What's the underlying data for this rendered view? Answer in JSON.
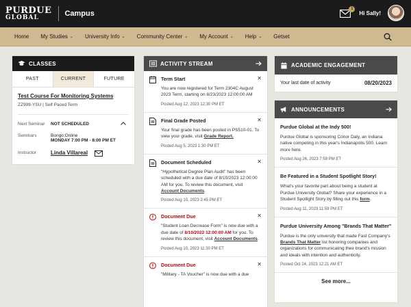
{
  "header": {
    "logo_line1": "PURDUE",
    "logo_line2": "GLOBAL",
    "campus": "Campus",
    "mail_count": "1",
    "greeting": "Hi Sally!"
  },
  "nav": {
    "items": [
      {
        "label": "Home",
        "dropdown": false
      },
      {
        "label": "My Studies",
        "dropdown": true
      },
      {
        "label": "University Info",
        "dropdown": true
      },
      {
        "label": "Community Center",
        "dropdown": true
      },
      {
        "label": "My Account",
        "dropdown": true
      },
      {
        "label": "Help",
        "dropdown": true
      },
      {
        "label": "Getset",
        "dropdown": false
      }
    ],
    "chevron": "⌄"
  },
  "classes": {
    "title": "CLASSES",
    "tabs": [
      "PAST",
      "CURRENT",
      "FUTURE"
    ],
    "course_title": "Test Course For Monitoring Systems",
    "course_sub": "ZZ999-YSU | Self Paced Term",
    "next_seminar_label": "Next Seminar",
    "next_seminar_value": "NOT SCHEDULED",
    "seminars_label": "Seminars",
    "seminars_value1": "Bongo:Online",
    "seminars_value2": "MONDAY 7:00 PM - 8:00 PM ET",
    "instructor_label": "Instructor",
    "instructor_name": "Linda Villareal"
  },
  "activity": {
    "title": "ACTIVITY STREAM",
    "items": [
      {
        "title": "Term Start",
        "body": "You are now registered for Term 2304C August 2023 Term, starting on 8/23/2023 12:00:00 AM",
        "date": "Posted Aug 12, 2023   12:30 PM ET"
      },
      {
        "title": "Final Grade Posted",
        "body_pre": "Your final grade has been posted in PS510-01. To view your grade, visit ",
        "body_link": "Grade Report.",
        "date": "Posted Aug 5, 2023   1:30 PM ET"
      },
      {
        "title": "Document Scheduled",
        "body_pre": "\"Hypothetical Degree Plan Audit\" has been scheduled with a due date of 8/10/2023 12:00:00 AM for you. To review this document, visit ",
        "body_link": "Account Documents",
        "body_post": ".",
        "date": "Posted Aug 10, 2023   2:45 PM ET"
      },
      {
        "title": "Document Due",
        "body_pre": "\"Student Loan Decrease Form\" is now due with a due date of ",
        "body_red": "8/10/2022 12:00:00 AM",
        "body_mid": " for you. To review this document, visit ",
        "body_link": "Account Documents",
        "body_post": ".",
        "date": "Posted Aug 10, 2023   11:30 PM ET"
      },
      {
        "title": "Document Due",
        "body_pre": "\"Military - TA Voucher\" is now due with a due"
      }
    ]
  },
  "engagement": {
    "title": "ACADEMIC ENGAGEMENT",
    "label": "Your last date of activity",
    "date": "08/20/2023"
  },
  "announcements": {
    "title": "ANNOUNCEMENTS",
    "items": [
      {
        "title": "Purdue Global at the Indy 500!",
        "body": "Purdue Global is sponsoring Conor Daly, an Indiana native competing in this year's Indianapolis 500. Learn more here.",
        "date": "Posted Aug 26, 2023 7:59 PM ET"
      },
      {
        "title": "Be Featured in a Student Spotlight Story!",
        "body_pre": "What's your favorite part about being a student at Purdue University Global? Share your experience in a Student Spotlight Story by filling out this ",
        "body_link": "form",
        "body_post": ".",
        "date": "Posted Aug 11, 2023 11:59 PM ET"
      },
      {
        "title": "Purdue University Among \"Brands That Matter\"",
        "body_pre": "Purdue is the only university that made Fast Company's ",
        "body_link": "Brands That Matter",
        "body_post": " list honoring companies and organizations for communicating their brand's mission and ideals with intention and authenticity.",
        "date": "Posted Oct 24, 2023 12:21 AM ET"
      }
    ],
    "see_more": "See more..."
  },
  "colors": {
    "black": "#1b1b1b",
    "gold": "#cfb991",
    "red": "#b50c0c",
    "background": "#e8e6e1"
  }
}
